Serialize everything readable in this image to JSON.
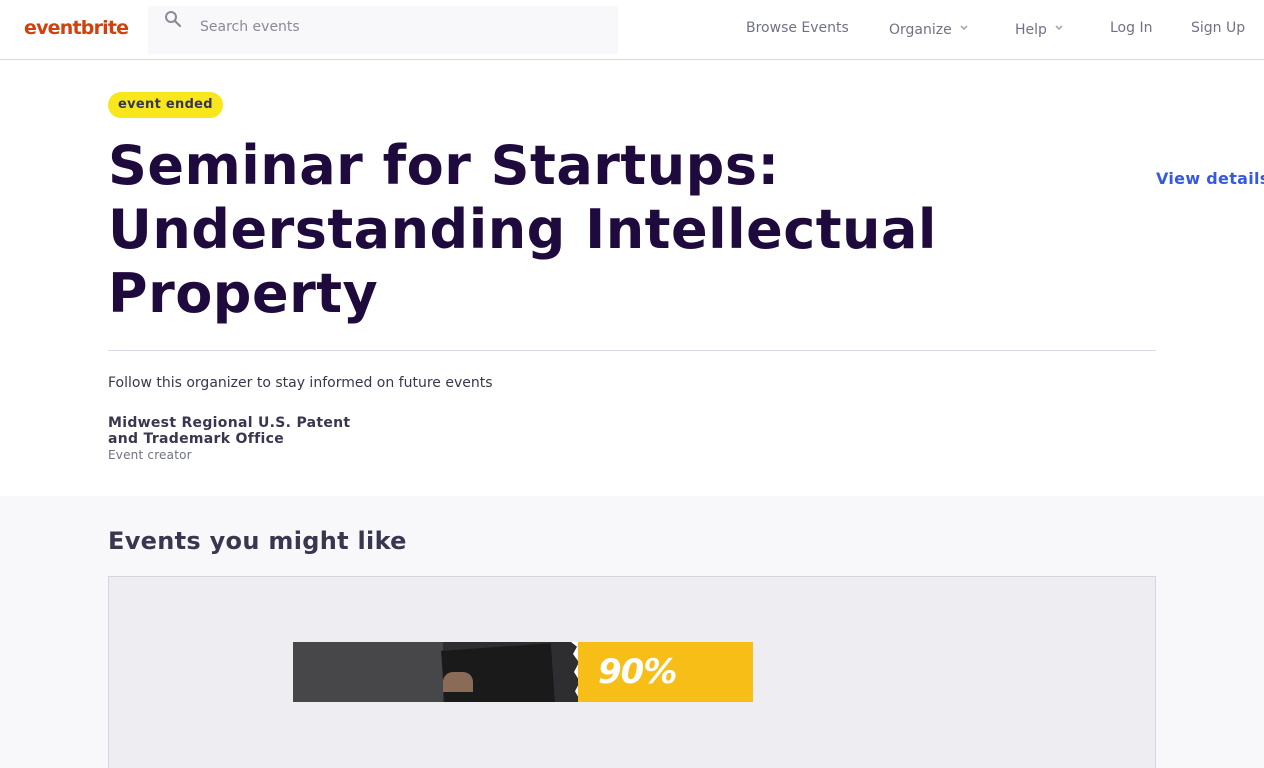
{
  "header": {
    "logo": "eventbrite",
    "search": {
      "placeholder": "Search events"
    },
    "nav": {
      "browse": "Browse Events",
      "organize": "Organize",
      "help": "Help",
      "login": "Log In",
      "signup": "Sign Up"
    }
  },
  "event": {
    "status_badge": "event ended",
    "title": "Seminar for Startups: Understanding Intellectual Property",
    "view_details": "View details",
    "follow_text": "Follow this organizer to stay informed on future events",
    "organizer": {
      "name": "Midwest Regional U.S. Patent and Trademark Office",
      "role": "Event creator"
    }
  },
  "recommendations": {
    "heading": "Events you might like",
    "card_image_text": "90%"
  },
  "colors": {
    "brand": "#d1410c",
    "badge": "#f8e71c",
    "link": "#3659e3",
    "title": "#1e0a3c"
  }
}
